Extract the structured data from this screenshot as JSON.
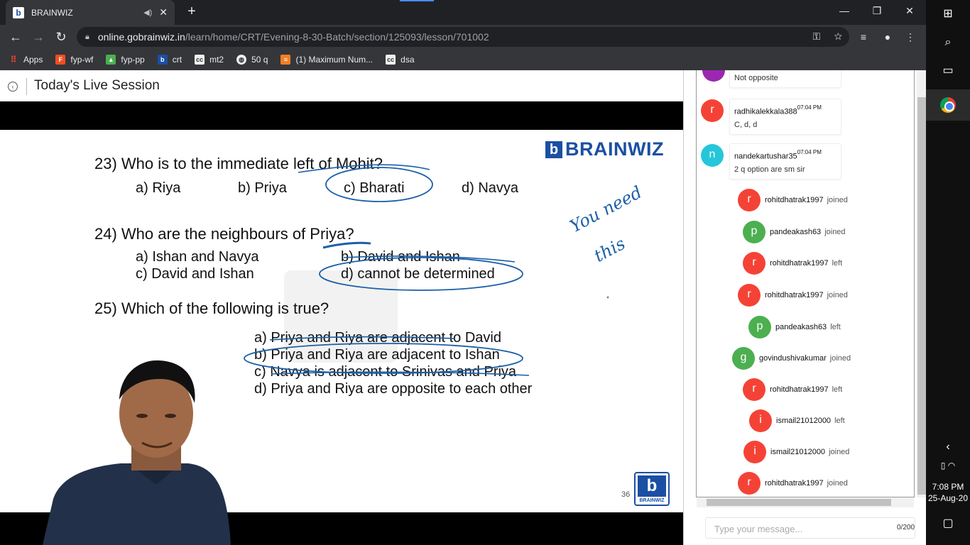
{
  "browser": {
    "tab_title": "BRAINWIZ",
    "tab_favicon": "b",
    "url_host": "online.gobrainwiz.in",
    "url_path": "/learn/home/CRT/Evening-8-30-Batch/section/125093/lesson/701002",
    "bookmarks": [
      {
        "label": "Apps",
        "icon": "apps-grid-icon",
        "color": "#e8eaed"
      },
      {
        "label": "fyp-wf",
        "icon": "figma-icon",
        "color": "#f24e1e"
      },
      {
        "label": "fyp-pp",
        "icon": "image-icon",
        "color": "#4caf50"
      },
      {
        "label": "crt",
        "icon": "brainwiz-icon",
        "color": "#1b4fa3"
      },
      {
        "label": "mt2",
        "icon": "cc-icon",
        "color": "#555555"
      },
      {
        "label": "50 q",
        "icon": "globe-icon",
        "color": "#888888"
      },
      {
        "label": "(1) Maximum Num...",
        "icon": "stack-icon",
        "color": "#f48024"
      },
      {
        "label": "dsa",
        "icon": "cc-icon",
        "color": "#555555"
      }
    ]
  },
  "header": {
    "title": "Today's Live Session"
  },
  "slide": {
    "brand_text": "BRAINWIZ",
    "q23": "23) Who is to the immediate left of Mohit?",
    "q23_opts": [
      "a) Riya",
      "b) Priya",
      "c) Bharati",
      "d) Navya"
    ],
    "q24": "24) Who are the neighbours of Priya?",
    "q24_opts": [
      "a) Ishan and Navya",
      "b) David and Ishan",
      "c) David and Ishan",
      "d) cannot be determined"
    ],
    "q25": "25) Which of the following is true?",
    "q25_opts": [
      "a) Priya and Riya are adjacent to David",
      "b) Priya and Riya are adjacent to Ishan",
      "c) Navya is adjacent to Srinivas and Priya",
      "d) Priya and Riya are opposite to each other"
    ],
    "slide_number": "36",
    "logo_label": "BRAINWIZ",
    "note_line1": "You need",
    "note_line2": "this",
    "accent": "#1b5fa8"
  },
  "chat": {
    "messages": [
      {
        "name": "",
        "time": "",
        "text": "Not opposite",
        "avatar": "",
        "color": "#9c27b0"
      },
      {
        "name": "radhikalekkala388",
        "time": "07:04 PM",
        "text": "C, d, d",
        "avatar": "r",
        "color": "#f44336"
      },
      {
        "name": "nandekartushar35",
        "time": "07:04 PM",
        "text": "2 q option are sm sir",
        "avatar": "n",
        "color": "#26c6da"
      }
    ],
    "events": [
      {
        "user": "rohitdhatrak1997",
        "action": "joined",
        "avatar": "r",
        "color": "#f44336"
      },
      {
        "user": "pandeakash63",
        "action": "joined",
        "avatar": "p",
        "color": "#4caf50"
      },
      {
        "user": "rohitdhatrak1997",
        "action": "left",
        "avatar": "r",
        "color": "#f44336"
      },
      {
        "user": "rohitdhatrak1997",
        "action": "joined",
        "avatar": "r",
        "color": "#f44336"
      },
      {
        "user": "pandeakash63",
        "action": "left",
        "avatar": "p",
        "color": "#4caf50"
      },
      {
        "user": "govindushivakumar",
        "action": "joined",
        "avatar": "g",
        "color": "#4caf50"
      },
      {
        "user": "rohitdhatrak1997",
        "action": "left",
        "avatar": "r",
        "color": "#f44336"
      },
      {
        "user": "ismail21012000",
        "action": "left",
        "avatar": "i",
        "color": "#f44336"
      },
      {
        "user": "ismail21012000",
        "action": "joined",
        "avatar": "i",
        "color": "#f44336"
      },
      {
        "user": "rohitdhatrak1997",
        "action": "joined",
        "avatar": "r",
        "color": "#f44336"
      }
    ],
    "input_placeholder": "Type your message...",
    "counter": "0/200"
  },
  "taskbar": {
    "time": "7:08 PM",
    "date": "25-Aug-20"
  }
}
